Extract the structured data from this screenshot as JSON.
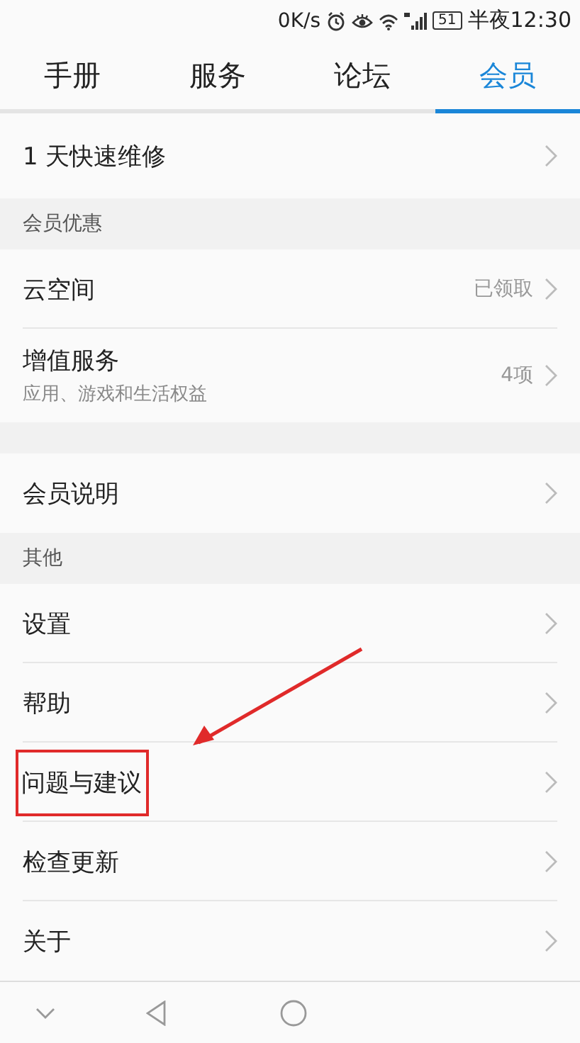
{
  "status_bar": {
    "speed": "0K/s",
    "battery": "51",
    "time": "半夜12:30"
  },
  "tabs": [
    {
      "label": "手册",
      "selected": false
    },
    {
      "label": "服务",
      "selected": false
    },
    {
      "label": "论坛",
      "selected": false
    },
    {
      "label": "会员",
      "selected": true
    }
  ],
  "groups": [
    {
      "rows": [
        {
          "title": "1 天快速维修",
          "highlighted": false
        }
      ]
    },
    {
      "header": "会员优惠",
      "rows": [
        {
          "title": "云空间",
          "value": "已领取",
          "highlighted": false
        },
        {
          "title": "增值服务",
          "subtitle": "应用、游戏和生活权益",
          "value": "4项",
          "highlighted": false
        }
      ]
    },
    {
      "rows": [
        {
          "title": "会员说明",
          "highlighted": false
        }
      ]
    },
    {
      "header": "其他",
      "rows": [
        {
          "title": "设置",
          "highlighted": false
        },
        {
          "title": "帮助",
          "highlighted": false
        },
        {
          "title": "问题与建议",
          "highlighted": true
        },
        {
          "title": "检查更新",
          "highlighted": false
        },
        {
          "title": "关于",
          "highlighted": false
        }
      ]
    }
  ]
}
